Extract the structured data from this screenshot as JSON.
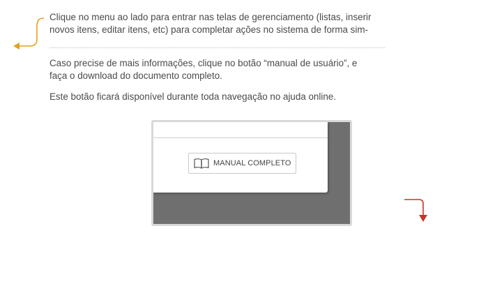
{
  "help_text": {
    "intro_line_1": "Clique no menu ao lado para entrar nas telas de gerenciamento (listas, inserir",
    "intro_line_2": "novos itens, editar itens, etc) para completar ações no sistema de forma sim-",
    "info_line_1": "Caso precise de mais informações, clique no botão “manual de usuário”, e",
    "info_line_2": "faça o download do documento completo.",
    "note": "Este botão ficará disponível durante toda navegação no ajuda online."
  },
  "preview": {
    "manual_button_label": "MANUAL COMPLETO",
    "manual_button_icon": "book-icon"
  },
  "colors": {
    "left_arrow": "#e0a21a",
    "right_arrow": "#c8352a",
    "text": "#4a4a4a",
    "preview_backdrop": "#6f6f6f"
  }
}
